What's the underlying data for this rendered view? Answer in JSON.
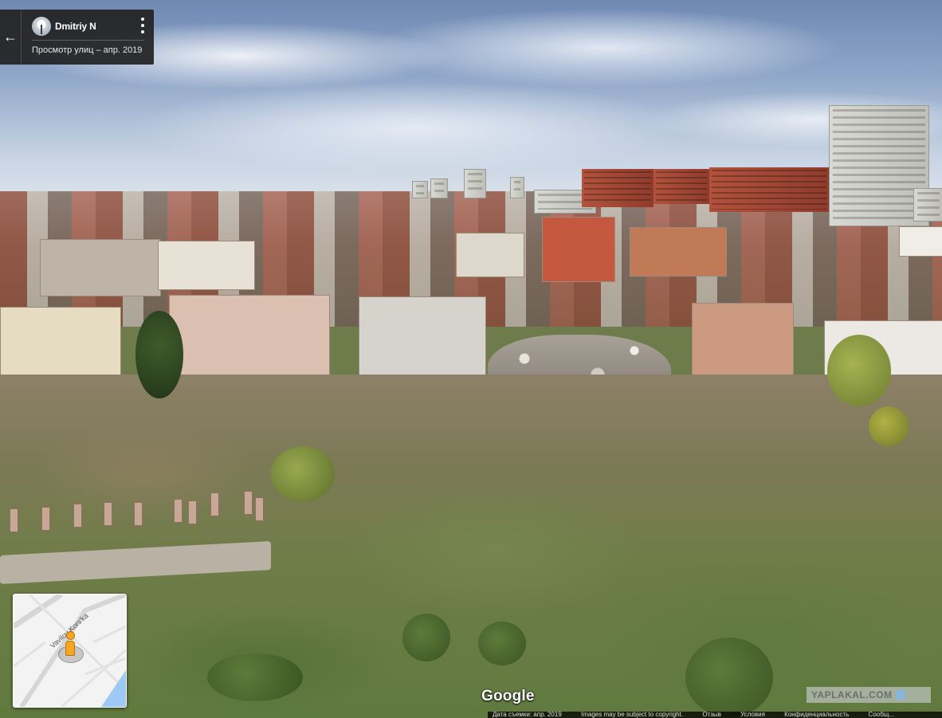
{
  "app": {
    "title": "Google Street View",
    "google_label": "Google"
  },
  "info_card": {
    "back_icon": "arrow-left-icon",
    "back_glyph": "←",
    "author": "Dmitriy N",
    "subtitle": "Просмотр улиц – апр. 2019",
    "more_icon": "more-vertical-icon"
  },
  "minimap": {
    "street_label": "Vavilov Kors'ka",
    "marker_icon": "pegman-icon",
    "water_color": "#9ec9f5"
  },
  "watermark": {
    "text": "YAPLAKAL.COM"
  },
  "footer": {
    "items": [
      "Дата съемки: апр. 2019",
      "Images may be subject to copyright.",
      "Отзыв",
      "Условия",
      "Конфиденциальность",
      "Сообщ..."
    ]
  },
  "colors": {
    "card_bg": "#222222",
    "pegman": "#f5a623"
  }
}
